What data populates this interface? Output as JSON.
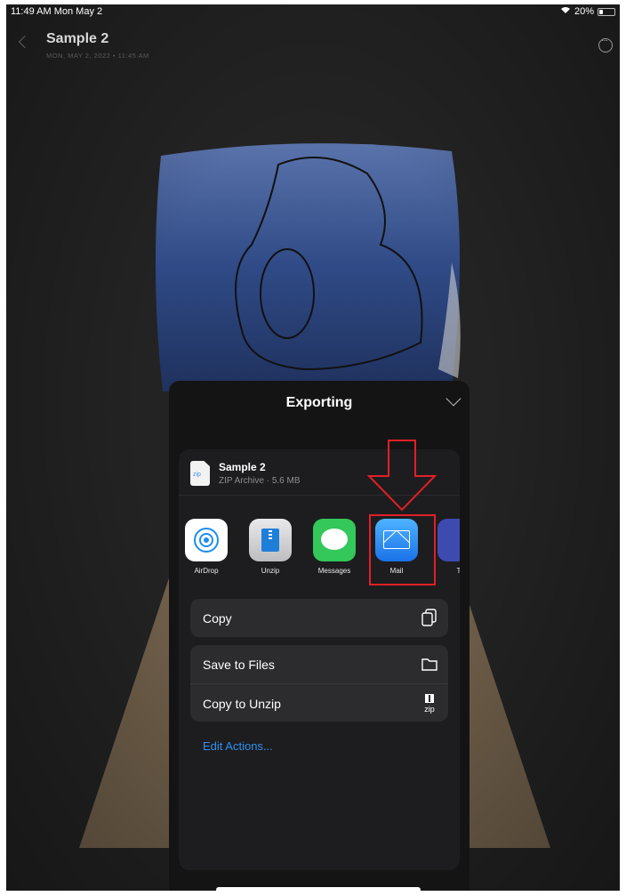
{
  "status_bar": {
    "time": "11:49 AM  Mon May 2",
    "battery_text": "20%",
    "battery_level": 0.2
  },
  "nav": {
    "title": "Sample 2",
    "subtitle": "MON, MAY 2, 2022 • 11:45 AM"
  },
  "sheet": {
    "title": "Exporting",
    "file": {
      "name": "Sample 2",
      "meta": "ZIP Archive · 5.6 MB",
      "icon_text": "zip"
    },
    "apps": [
      {
        "label": "AirDrop",
        "icon": "airdrop-icon"
      },
      {
        "label": "Unzip",
        "icon": "unzip-icon"
      },
      {
        "label": "Messages",
        "icon": "messages-icon"
      },
      {
        "label": "Mail",
        "icon": "mail-icon"
      },
      {
        "label": "T",
        "icon": "partial-app-icon"
      }
    ],
    "actions_group1": [
      {
        "label": "Copy",
        "icon": "copy-icon"
      }
    ],
    "actions_group2": [
      {
        "label": "Save to Files",
        "icon": "folder-icon"
      },
      {
        "label": "Copy to Unzip",
        "icon": "unzip-zip-icon",
        "icon_text": "zip"
      }
    ],
    "edit_actions": "Edit Actions..."
  },
  "colors": {
    "highlight": "#e21f26",
    "link": "#2f8ff0",
    "sheet_bg": "#141414"
  }
}
